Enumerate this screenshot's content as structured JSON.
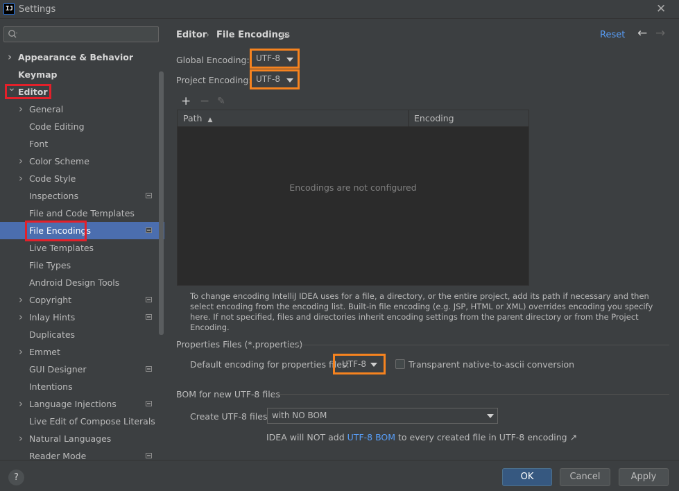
{
  "window": {
    "title": "Settings",
    "app_icon_text": "IJ"
  },
  "sidebar": {
    "search_placeholder": "",
    "items": [
      {
        "label": "Appearance & Behavior",
        "bold": true,
        "chevron": "right"
      },
      {
        "label": "Keymap",
        "bold": true
      },
      {
        "label": "Editor",
        "bold": true,
        "chevron": "down"
      },
      {
        "label": "General",
        "chevron": "right"
      },
      {
        "label": "Code Editing"
      },
      {
        "label": "Font"
      },
      {
        "label": "Color Scheme",
        "chevron": "right"
      },
      {
        "label": "Code Style",
        "chevron": "right"
      },
      {
        "label": "Inspections",
        "project_icon": true
      },
      {
        "label": "File and Code Templates"
      },
      {
        "label": "File Encodings",
        "selected": true,
        "project_icon": true
      },
      {
        "label": "Live Templates"
      },
      {
        "label": "File Types"
      },
      {
        "label": "Android Design Tools"
      },
      {
        "label": "Copyright",
        "chevron": "right",
        "project_icon": true
      },
      {
        "label": "Inlay Hints",
        "chevron": "right",
        "project_icon": true
      },
      {
        "label": "Duplicates"
      },
      {
        "label": "Emmet",
        "chevron": "right"
      },
      {
        "label": "GUI Designer",
        "project_icon": true
      },
      {
        "label": "Intentions"
      },
      {
        "label": "Language Injections",
        "chevron": "right",
        "project_icon": true
      },
      {
        "label": "Live Edit of Compose Literals"
      },
      {
        "label": "Natural Languages",
        "chevron": "right"
      },
      {
        "label": "Reader Mode",
        "project_icon": true
      }
    ]
  },
  "header": {
    "breadcrumb_parent": "Editor",
    "breadcrumb_sep": "›",
    "breadcrumb_page": "File Encodings",
    "reset_label": "Reset",
    "back_icon": "←",
    "forward_icon": "→"
  },
  "encodings": {
    "global_label": "Global Encoding:",
    "global_value": "UTF-8",
    "project_label": "Project Encoding:",
    "project_value": "UTF-8"
  },
  "table": {
    "add_icon": "+",
    "remove_icon": "−",
    "edit_icon": "✎",
    "columns": [
      "Path",
      "Encoding"
    ],
    "sort_indicator": "▲",
    "empty_message": "Encodings are not configured"
  },
  "help_text": "To change encoding IntelliJ IDEA uses for a file, a directory, or the entire project, add its path if necessary and then select encoding from the encoding list. Built-in file encoding (e.g. JSP, HTML or XML) overrides encoding you specify here. If not specified, files and directories inherit encoding settings from the parent directory or from the Project Encoding.",
  "properties": {
    "section_title": "Properties Files (*.properties)",
    "default_label": "Default encoding for properties files:",
    "default_value": "UTF-8",
    "transparent_label": "Transparent native-to-ascii conversion",
    "transparent_checked": false
  },
  "bom": {
    "section_title": "BOM for new UTF-8 files",
    "create_label": "Create UTF-8 files:",
    "create_value": "with NO BOM",
    "note_prefix": "IDEA will NOT add ",
    "note_link": "UTF-8 BOM",
    "note_suffix": " to every created file in UTF-8 encoding ↗"
  },
  "footer": {
    "help_label": "?",
    "ok_label": "OK",
    "cancel_label": "Cancel",
    "apply_label": "Apply"
  },
  "colors": {
    "accent": "#4b6eaf",
    "link": "#589df6",
    "highlight_red": "#e3202a",
    "highlight_orange": "#f6831f"
  }
}
